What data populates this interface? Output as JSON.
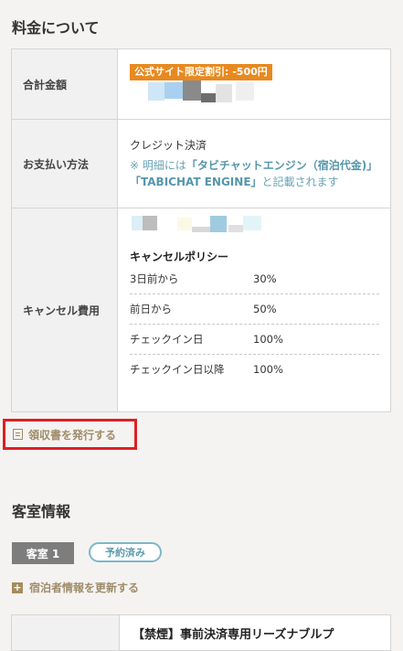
{
  "fee_section": {
    "title": "料金について",
    "total": {
      "label": "合計金額",
      "discount_badge": "公式サイト限定割引: -500円"
    },
    "payment": {
      "label": "お支払い方法",
      "method": "クレジット決済",
      "note_prefix": "※ 明細には",
      "note_bold": "「タビチャットエンジン（宿泊代金)」「TABICHAT ENGINE」",
      "note_suffix": "と記載されます"
    },
    "cancel": {
      "label": "キャンセル費用",
      "policy_title": "キャンセルポリシー",
      "rows": [
        {
          "when": "3日前から",
          "rate": "30%"
        },
        {
          "when": "前日から",
          "rate": "50%"
        },
        {
          "when": "チェックイン日",
          "rate": "100%"
        },
        {
          "when": "チェックイン日以降",
          "rate": "100%"
        }
      ]
    }
  },
  "receipt_link": "領収書を発行する",
  "room_section": {
    "title": "客室情報",
    "room_tag": "客室 1",
    "status": "予約済み",
    "update_link": "宿泊者情報を更新する",
    "plan_name": "【禁煙】事前決済専用リーズナブルプ"
  },
  "colors": {
    "badge": "#e8891f",
    "link_gold": "#a08c6a",
    "highlight_red": "#e01e24",
    "note_blue": "#6aa3b5"
  }
}
